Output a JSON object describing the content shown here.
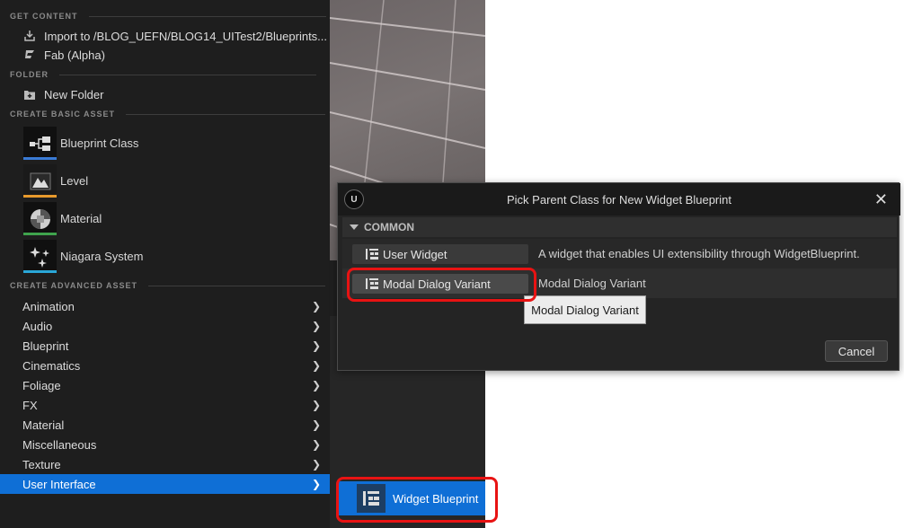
{
  "menu": {
    "sections": {
      "get_content": "GET CONTENT",
      "folder": "FOLDER",
      "basic": "CREATE BASIC ASSET",
      "advanced": "CREATE ADVANCED ASSET"
    },
    "import_label": "Import to /BLOG_UEFN/BLOG14_UITest2/Blueprints...",
    "fab_label": "Fab (Alpha)",
    "new_folder_label": "New Folder",
    "basic_assets": [
      {
        "label": "Blueprint Class",
        "color": "#3a7bd5"
      },
      {
        "label": "Level",
        "color": "#e89a2c"
      },
      {
        "label": "Material",
        "color": "#3fa34d"
      },
      {
        "label": "Niagara System",
        "color": "#2aa7d8"
      }
    ],
    "advanced": [
      "Animation",
      "Audio",
      "Blueprint",
      "Cinematics",
      "Foliage",
      "FX",
      "Material",
      "Miscellaneous",
      "Texture",
      "User Interface"
    ],
    "selected_advanced": "User Interface"
  },
  "submenu": {
    "widget_blueprint_label": "Widget Blueprint"
  },
  "dialog": {
    "title": "Pick Parent Class for New Widget Blueprint",
    "category": "COMMON",
    "classes": [
      {
        "name": "User Widget",
        "description": "A widget that enables UI extensibility through WidgetBlueprint."
      },
      {
        "name": "Modal Dialog Variant",
        "description": "Modal Dialog Variant"
      }
    ],
    "tooltip": "Modal Dialog Variant",
    "cancel_label": "Cancel"
  },
  "colors": {
    "accent": "#0f6fd6",
    "highlight": "#e81313"
  }
}
